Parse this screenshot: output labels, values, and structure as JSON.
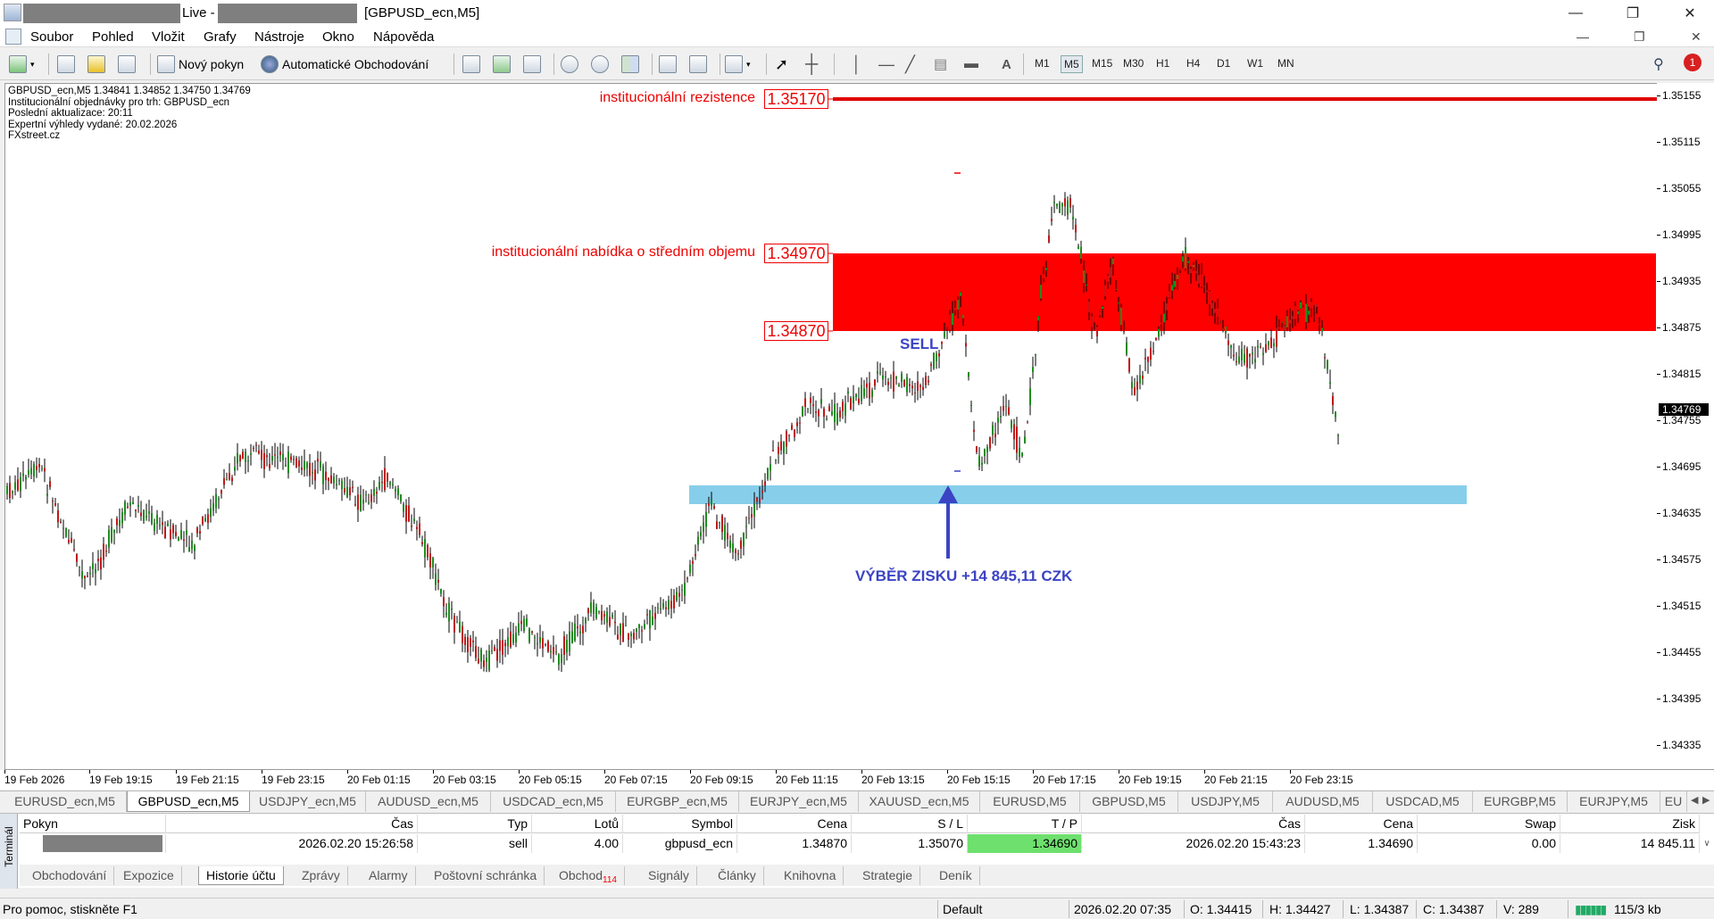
{
  "window": {
    "title_live": "Live -",
    "title_chart": "[GBPUSD_ecn,M5]",
    "btn_min": "—",
    "btn_max": "❐",
    "btn_close": "✕"
  },
  "menu": [
    "Soubor",
    "Pohled",
    "Vložit",
    "Grafy",
    "Nástroje",
    "Okno",
    "Nápověda"
  ],
  "toolbar": {
    "new_order": "Nový pokyn",
    "auto_trading": "Automatické Obchodování",
    "timeframes": [
      "M1",
      "M5",
      "M15",
      "M30",
      "H1",
      "H4",
      "D1",
      "W1",
      "MN"
    ],
    "active_timeframe": "M5",
    "text_tool": "A",
    "notification_count": "1"
  },
  "chart": {
    "info_lines": [
      "GBPUSD_ecn,M5  1.34841 1.34852 1.34750 1.34769",
      "Institucionální objednávky pro trh: GBPUSD_ecn",
      "Poslední aktualizace: 20:11",
      "Expertní výhledy vydané: 20.02.2026",
      "FXstreet.cz"
    ],
    "resistance_label": "institucionální rezistence",
    "resistance_price": "1.35170",
    "supply_label": "institucionální nabídka o středním objemu",
    "supply_top": "1.34970",
    "supply_bottom": "1.34870",
    "sell_label": "SELL",
    "profit_label": "VÝBĚR ZISKU +14 845,11 CZK",
    "current_price": "1.34769",
    "colors": {
      "bull": "#1e8c1e",
      "bear": "#c01818",
      "zone_red": "#ff0000",
      "zone_blue": "#87ceeb",
      "arrow": "#3b44c4"
    }
  },
  "y_axis": [
    "1.35155",
    "1.35115",
    "1.35055",
    "1.34995",
    "1.34935",
    "1.34875",
    "1.34815",
    "1.34755",
    "1.34695",
    "1.34635",
    "1.34575",
    "1.34515",
    "1.34455",
    "1.34395",
    "1.34335"
  ],
  "x_axis": [
    "19 Feb 2026",
    "19 Feb 19:15",
    "19 Feb 21:15",
    "19 Feb 23:15",
    "20 Feb 01:15",
    "20 Feb 03:15",
    "20 Feb 05:15",
    "20 Feb 07:15",
    "20 Feb 09:15",
    "20 Feb 11:15",
    "20 Feb 13:15",
    "20 Feb 15:15",
    "20 Feb 17:15",
    "20 Feb 19:15",
    "20 Feb 21:15",
    "20 Feb 23:15"
  ],
  "symbol_tabs": [
    "EURUSD_ecn,M5",
    "GBPUSD_ecn,M5",
    "USDJPY_ecn,M5",
    "AUDUSD_ecn,M5",
    "USDCAD_ecn,M5",
    "EURGBP_ecn,M5",
    "EURJPY_ecn,M5",
    "XAUUSD_ecn,M5",
    "EURUSD,M5",
    "GBPUSD,M5",
    "USDJPY,M5",
    "AUDUSD,M5",
    "USDCAD,M5",
    "EURGBP,M5",
    "EURJPY,M5",
    "EU"
  ],
  "active_symbol_tab": 1,
  "terminal": {
    "side_label": "Terminál",
    "headers": [
      "Pokyn",
      "Čas",
      "Typ",
      "Lotů",
      "Symbol",
      "Cena",
      "S / L",
      "T / P",
      "Čas",
      "Cena",
      "Swap",
      "Zisk"
    ],
    "row": [
      "",
      "2026.02.20 15:26:58",
      "sell",
      "4.00",
      "gbpusd_ecn",
      "1.34870",
      "1.35070",
      "1.34690",
      "2026.02.20 15:43:23",
      "1.34690",
      "0.00",
      "14 845.11"
    ],
    "tabs": [
      "Obchodování",
      "Expozice",
      "Historie účtu",
      "Zprávy",
      "Alarmy",
      "Poštovní schránka",
      "Obchod",
      "Signály",
      "Články",
      "Knihovna",
      "Strategie",
      "Deník"
    ],
    "active_tab": 2,
    "trade_badge": "114"
  },
  "status": {
    "help": "Pro pomoc, stiskněte F1",
    "profile": "Default",
    "datetime": "2026.02.20 07:35",
    "open": "O: 1.34415",
    "high": "H: 1.34427",
    "low": "L: 1.34387",
    "close": "C: 1.34387",
    "volume": "V: 289",
    "traffic": "115/3 kb"
  }
}
